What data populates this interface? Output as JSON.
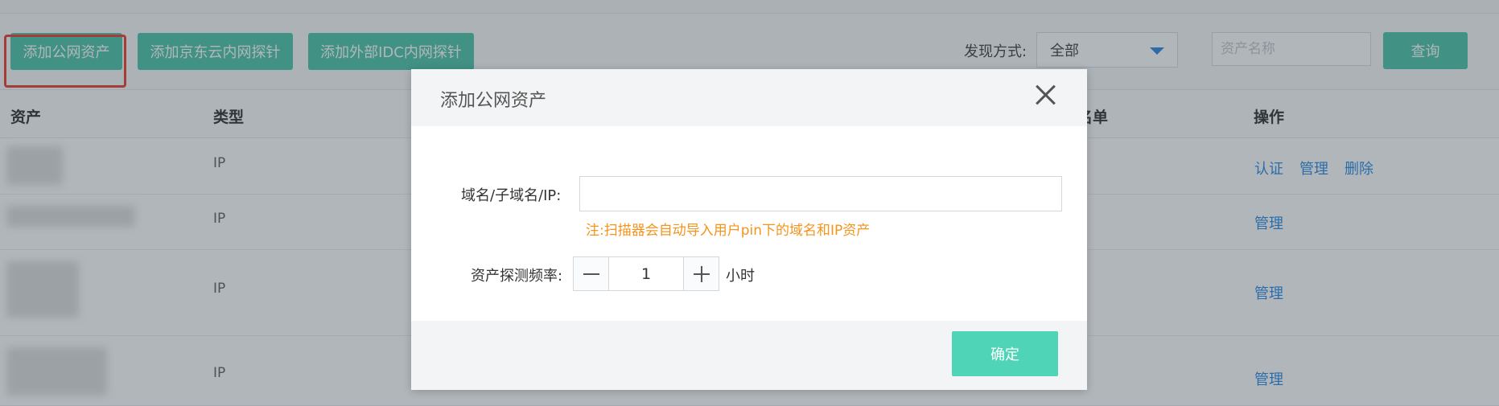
{
  "toolbar": {
    "add_public_label": "添加公网资产",
    "add_jd_label": "添加京东云内网探针",
    "add_idc_label": "添加外部IDC内网探针",
    "filter_label": "发现方式:",
    "filter_value": "全部",
    "asset_placeholder": "资产名称",
    "query_label": "查询"
  },
  "table": {
    "headers": {
      "asset": "资产",
      "type": "类型",
      "whitelist": "白名单",
      "ops": "操作"
    },
    "rows": [
      {
        "type": "IP",
        "actions": [
          "认证",
          "管理",
          "删除"
        ]
      },
      {
        "type": "IP",
        "actions": [
          "管理"
        ]
      },
      {
        "type": "IP",
        "actions": [
          "管理"
        ]
      },
      {
        "type": "IP",
        "actions": [
          "管理"
        ]
      }
    ]
  },
  "modal": {
    "title": "添加公网资产",
    "domain_label": "域名/子域名/IP:",
    "domain_value": "",
    "note": "注:扫描器会自动导入用户pin下的域名和IP资产",
    "freq_label": "资产探测频率:",
    "freq_value": "1",
    "freq_unit": "小时",
    "confirm_label": "确定"
  },
  "colors": {
    "accent_green": "#3fbfa2",
    "confirm_green": "#4fd4b7",
    "link_blue": "#1a82e2",
    "note_orange": "#f5941c",
    "highlight_red": "#e8301f"
  },
  "icons": [
    "close-icon",
    "minus-icon",
    "plus-icon",
    "caret-down-icon"
  ]
}
